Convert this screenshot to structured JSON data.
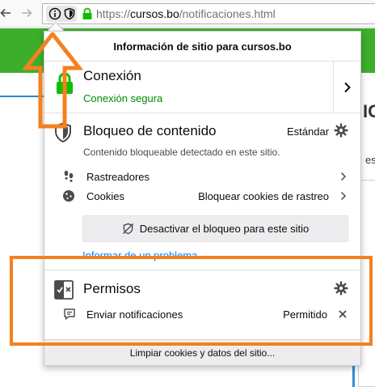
{
  "browser": {
    "url_host": "cursos.bo",
    "url_prefix": "https://",
    "url_path": "/notificaciones.html"
  },
  "page": {
    "fragment_heading": "IC",
    "fragment_text": "es"
  },
  "identity_panel": {
    "title": "Información de sitio para cursos.bo",
    "connection": {
      "title": "Conexión",
      "status": "Conexión segura",
      "status_color": "#058b00"
    },
    "content_blocking": {
      "title": "Bloqueo de contenido",
      "level": "Estándar",
      "description": "Contenido bloqueable detectado en este sitio.",
      "trackers_label": "Rastreadores",
      "cookies_label": "Cookies",
      "cookies_value": "Bloquear cookies de rastreo",
      "disable_button": "Desactivar el bloqueo para este sitio",
      "report_link": "Informar de un problema"
    },
    "permissions": {
      "title": "Permisos",
      "notifications_label": "Enviar notificaciones",
      "notifications_value": "Permitido"
    },
    "footer_button": "Limpiar cookies y datos del sitio..."
  },
  "annotation": {
    "color": "#f4801f"
  }
}
